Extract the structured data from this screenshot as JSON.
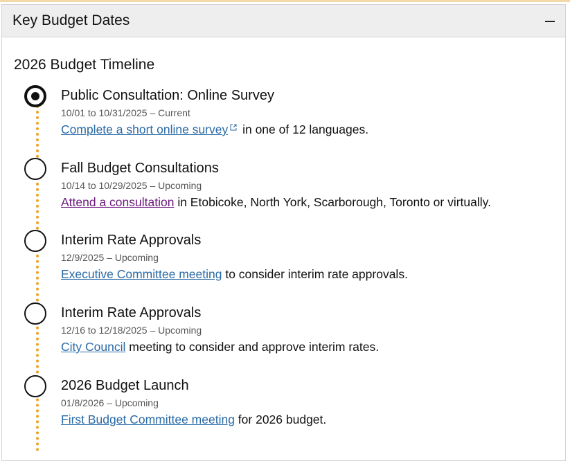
{
  "panel": {
    "title": "Key Budget Dates",
    "collapse_symbol": "−"
  },
  "timeline": {
    "title": "2026 Budget Timeline",
    "items": [
      {
        "title": "Public Consultation: Online Survey",
        "date": "10/01 to 10/31/2025 – Current",
        "link_text": "Complete a short online survey",
        "link_external": true,
        "rest_text": " in one of 12 languages.",
        "status": "current"
      },
      {
        "title": "Fall Budget Consultations",
        "date": "10/14 to 10/29/2025 – Upcoming",
        "link_text": "Attend a consultation",
        "link_visited": true,
        "rest_text": " in Etobicoke, North York, Scarborough, Toronto or virtually.",
        "status": "upcoming"
      },
      {
        "title": "Interim Rate Approvals",
        "date": "12/9/2025 – Upcoming",
        "link_text": "Executive Committee meeting",
        "rest_text": " to consider interim rate approvals.",
        "status": "upcoming"
      },
      {
        "title": "Interim Rate Approvals",
        "date": "12/16 to 12/18/2025 – Upcoming",
        "link_text": "City Council",
        "rest_text": " meeting to consider and approve interim rates.",
        "status": "upcoming"
      },
      {
        "title": "2026 Budget Launch",
        "date": "01/8/2026 – Upcoming",
        "link_text": "First Budget Committee meeting",
        "rest_text": " for 2026 budget.",
        "status": "upcoming"
      }
    ]
  },
  "colors": {
    "link": "#2a6aa6",
    "visited_link": "#6b1a7c",
    "timeline_dots": "#f0a21e",
    "header_bg": "#eeeeee"
  },
  "icons": {
    "external": "external-link-icon",
    "collapse": "minus-icon"
  }
}
